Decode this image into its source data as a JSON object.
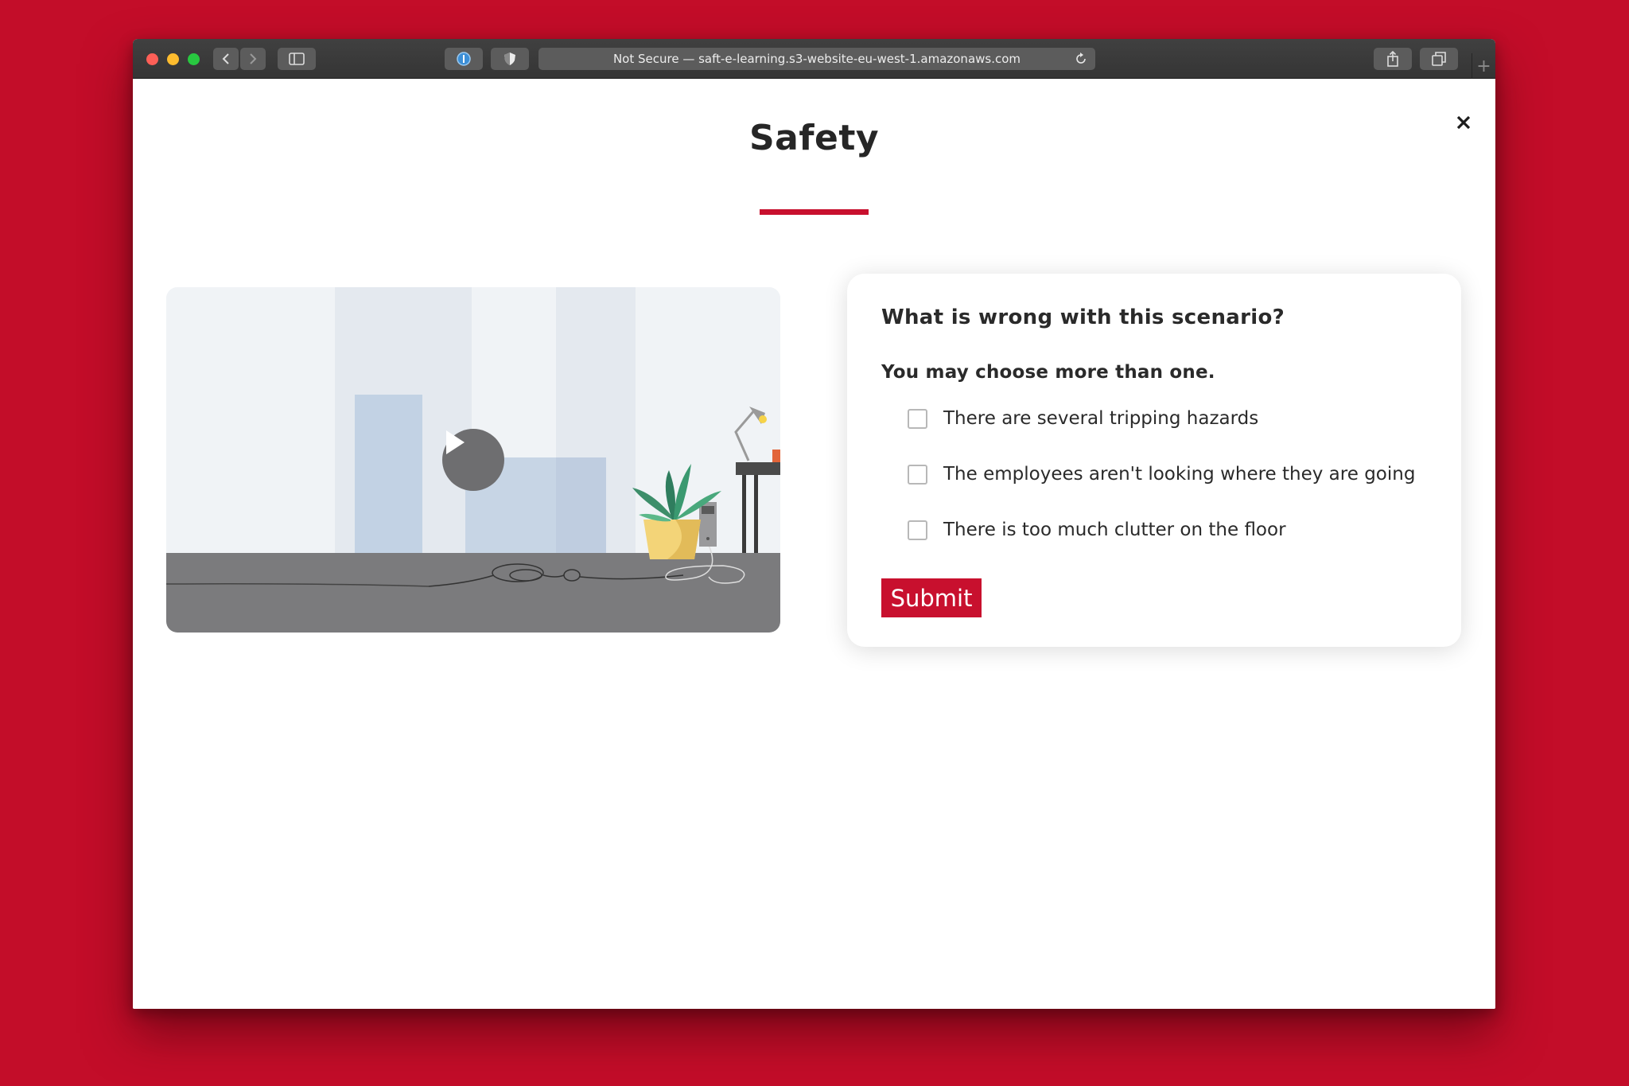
{
  "browser": {
    "address_text": "Not Secure — saft-e-learning.s3-website-eu-west-1.amazonaws.com",
    "icons": [
      "back-icon",
      "forward-icon",
      "sidebar-icon",
      "password-icon",
      "privacy-shield-icon",
      "reload-icon",
      "share-icon",
      "tabs-icon",
      "new-tab-icon"
    ],
    "new_tab_symbol": "+"
  },
  "page": {
    "title": "Safety",
    "accent_color": "#c8102e"
  },
  "video": {
    "play_icon": "play-icon"
  },
  "quiz": {
    "question": "What is wrong with this scenario?",
    "hint": "You may choose more than one.",
    "options": [
      {
        "label": "There are several tripping hazards",
        "checked": false
      },
      {
        "label": "The employees aren't looking where they are going",
        "checked": false
      },
      {
        "label": "There is too much clutter on the floor",
        "checked": false
      }
    ],
    "submit_label": "Submit"
  }
}
